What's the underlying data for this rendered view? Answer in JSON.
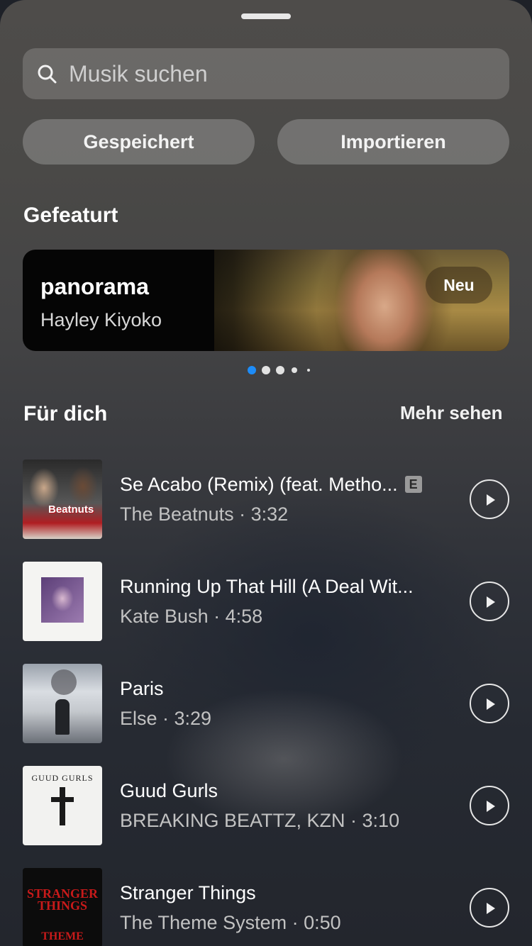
{
  "search": {
    "placeholder": "Musik suchen",
    "icon": "search-icon"
  },
  "buttons": {
    "saved": "Gespeichert",
    "import": "Importieren"
  },
  "featured": {
    "heading": "Gefeaturt",
    "card": {
      "title": "panorama",
      "artist": "Hayley Kiyoko",
      "badge": "Neu"
    },
    "pager": {
      "count": 5,
      "active_index": 0
    }
  },
  "for_you": {
    "heading": "Für dich",
    "more": "Mehr sehen",
    "songs": [
      {
        "title": "Se Acabo (Remix) (feat. Metho...",
        "explicit": "E",
        "meta": "The Beatnuts · 3:32",
        "cover_text": "Beatnuts"
      },
      {
        "title": "Running Up That Hill (A Deal Wit...",
        "meta": "Kate Bush · 4:58"
      },
      {
        "title": "Paris",
        "meta": "Else · 3:29"
      },
      {
        "title": "Guud Gurls",
        "meta": "BREAKING BEATTZ, KZN · 3:10",
        "cover_text": "GUUD GURLS"
      },
      {
        "title": "Stranger Things",
        "meta": "The Theme System · 0:50",
        "cover_text": "STRANGER THINGS",
        "cover_sub": "THEME"
      }
    ]
  },
  "colors": {
    "accent_dot": "#1d8cf8",
    "status_dot": "#35c75a"
  }
}
